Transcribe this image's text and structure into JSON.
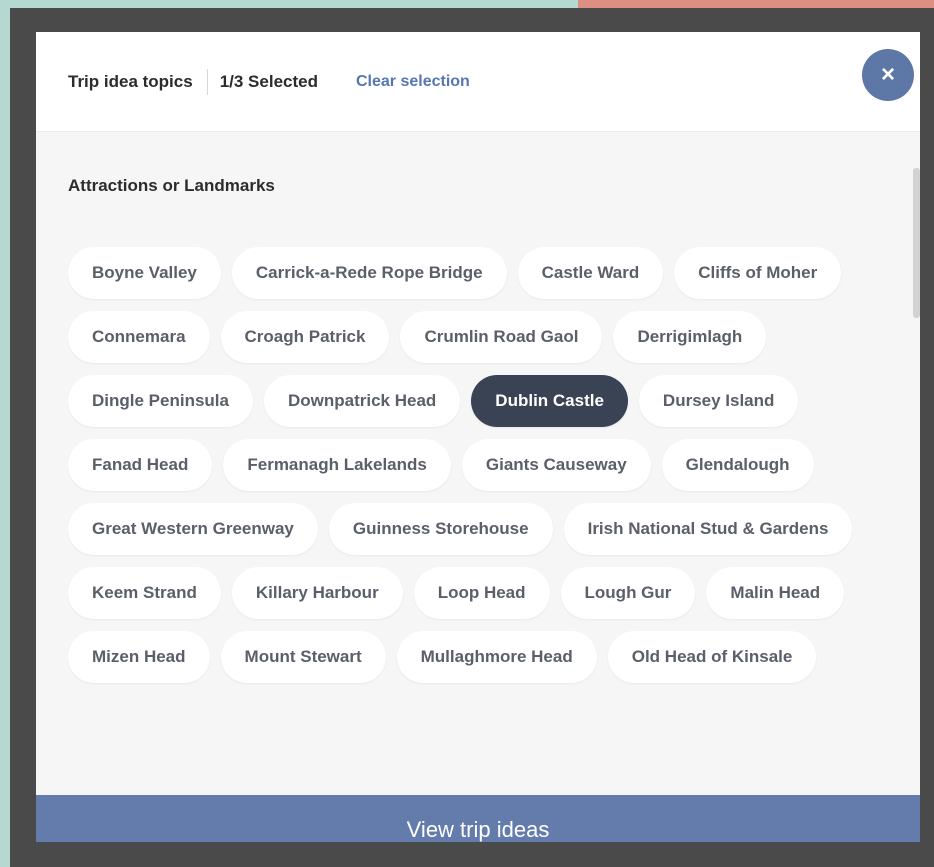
{
  "header": {
    "title": "Trip idea topics",
    "selected_count": "1/3 Selected",
    "clear_label": "Clear selection",
    "close_icon": "×"
  },
  "section": {
    "title": "Attractions or Landmarks",
    "chips": [
      {
        "label": "Boyne Valley",
        "selected": false
      },
      {
        "label": "Carrick-a-Rede Rope Bridge",
        "selected": false
      },
      {
        "label": "Castle Ward",
        "selected": false
      },
      {
        "label": "Cliffs of Moher",
        "selected": false
      },
      {
        "label": "Connemara",
        "selected": false
      },
      {
        "label": "Croagh Patrick",
        "selected": false
      },
      {
        "label": "Crumlin Road Gaol",
        "selected": false
      },
      {
        "label": "Derrigimlagh",
        "selected": false
      },
      {
        "label": "Dingle Peninsula",
        "selected": false
      },
      {
        "label": "Downpatrick Head",
        "selected": false
      },
      {
        "label": "Dublin Castle",
        "selected": true
      },
      {
        "label": "Dursey Island",
        "selected": false
      },
      {
        "label": "Fanad Head",
        "selected": false
      },
      {
        "label": "Fermanagh Lakelands",
        "selected": false
      },
      {
        "label": "Giants Causeway",
        "selected": false
      },
      {
        "label": "Glendalough",
        "selected": false
      },
      {
        "label": "Great Western Greenway",
        "selected": false
      },
      {
        "label": "Guinness Storehouse",
        "selected": false
      },
      {
        "label": "Irish National Stud & Gardens",
        "selected": false
      },
      {
        "label": "Keem Strand",
        "selected": false
      },
      {
        "label": "Killary Harbour",
        "selected": false
      },
      {
        "label": "Loop Head",
        "selected": false
      },
      {
        "label": "Lough Gur",
        "selected": false
      },
      {
        "label": "Malin Head",
        "selected": false
      },
      {
        "label": "Mizen Head",
        "selected": false
      },
      {
        "label": "Mount Stewart",
        "selected": false
      },
      {
        "label": "Mullaghmore Head",
        "selected": false
      },
      {
        "label": "Old Head of Kinsale",
        "selected": false
      }
    ]
  },
  "footer": {
    "button_label": "View trip ideas"
  },
  "colors": {
    "accent": "#5d77a6",
    "selected_chip": "#394354",
    "footer": "#637cab",
    "link": "#5577b5"
  },
  "icons": {
    "close": "close-icon",
    "footer_arrow": "chevron-right-icon"
  }
}
